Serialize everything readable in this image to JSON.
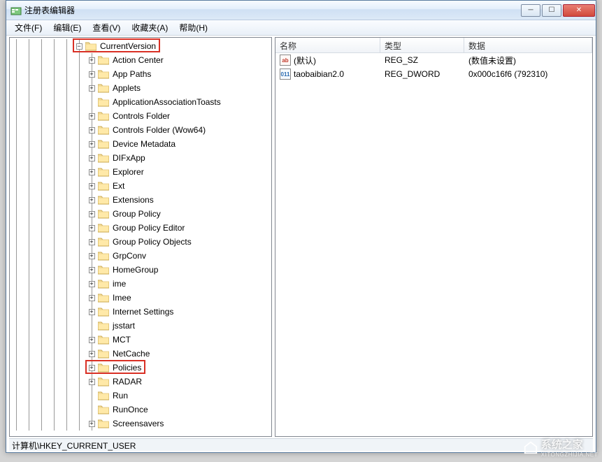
{
  "window": {
    "title": "注册表编辑器"
  },
  "menu": {
    "file": "文件(F)",
    "edit": "编辑(E)",
    "view": "查看(V)",
    "favorites": "收藏夹(A)",
    "help": "帮助(H)"
  },
  "tree": {
    "root_label": "CurrentVersion",
    "items": [
      {
        "label": "Action Center",
        "expandable": true
      },
      {
        "label": "App Paths",
        "expandable": true
      },
      {
        "label": "Applets",
        "expandable": true
      },
      {
        "label": "ApplicationAssociationToasts",
        "expandable": false
      },
      {
        "label": "Controls Folder",
        "expandable": true
      },
      {
        "label": "Controls Folder (Wow64)",
        "expandable": true
      },
      {
        "label": "Device Metadata",
        "expandable": true
      },
      {
        "label": "DIFxApp",
        "expandable": true
      },
      {
        "label": "Explorer",
        "expandable": true
      },
      {
        "label": "Ext",
        "expandable": true
      },
      {
        "label": "Extensions",
        "expandable": true
      },
      {
        "label": "Group Policy",
        "expandable": true
      },
      {
        "label": "Group Policy Editor",
        "expandable": true
      },
      {
        "label": "Group Policy Objects",
        "expandable": true
      },
      {
        "label": "GrpConv",
        "expandable": true
      },
      {
        "label": "HomeGroup",
        "expandable": true
      },
      {
        "label": "ime",
        "expandable": true
      },
      {
        "label": "Imee",
        "expandable": true
      },
      {
        "label": "Internet Settings",
        "expandable": true
      },
      {
        "label": "jsstart",
        "expandable": false
      },
      {
        "label": "MCT",
        "expandable": true
      },
      {
        "label": "NetCache",
        "expandable": true
      },
      {
        "label": "Policies",
        "expandable": true
      },
      {
        "label": "RADAR",
        "expandable": true
      },
      {
        "label": "Run",
        "expandable": false
      },
      {
        "label": "RunOnce",
        "expandable": false
      },
      {
        "label": "Screensavers",
        "expandable": true
      }
    ]
  },
  "list": {
    "headers": {
      "name": "名称",
      "type": "类型",
      "data": "数据"
    },
    "rows": [
      {
        "icon": "ab",
        "name": "(默认)",
        "type": "REG_SZ",
        "data": "(数值未设置)"
      },
      {
        "icon": "dw",
        "name": "taobaibian2.0",
        "type": "REG_DWORD",
        "data": "0x000c16f6 (792310)"
      }
    ]
  },
  "statusbar": {
    "path": "计算机\\HKEY_CURRENT_USER"
  },
  "watermark": {
    "text": "系统之家",
    "url": "XITONGZHIJIA.NET"
  },
  "highlights": [
    {
      "target": "CurrentVersion"
    },
    {
      "target": "Policies"
    }
  ]
}
